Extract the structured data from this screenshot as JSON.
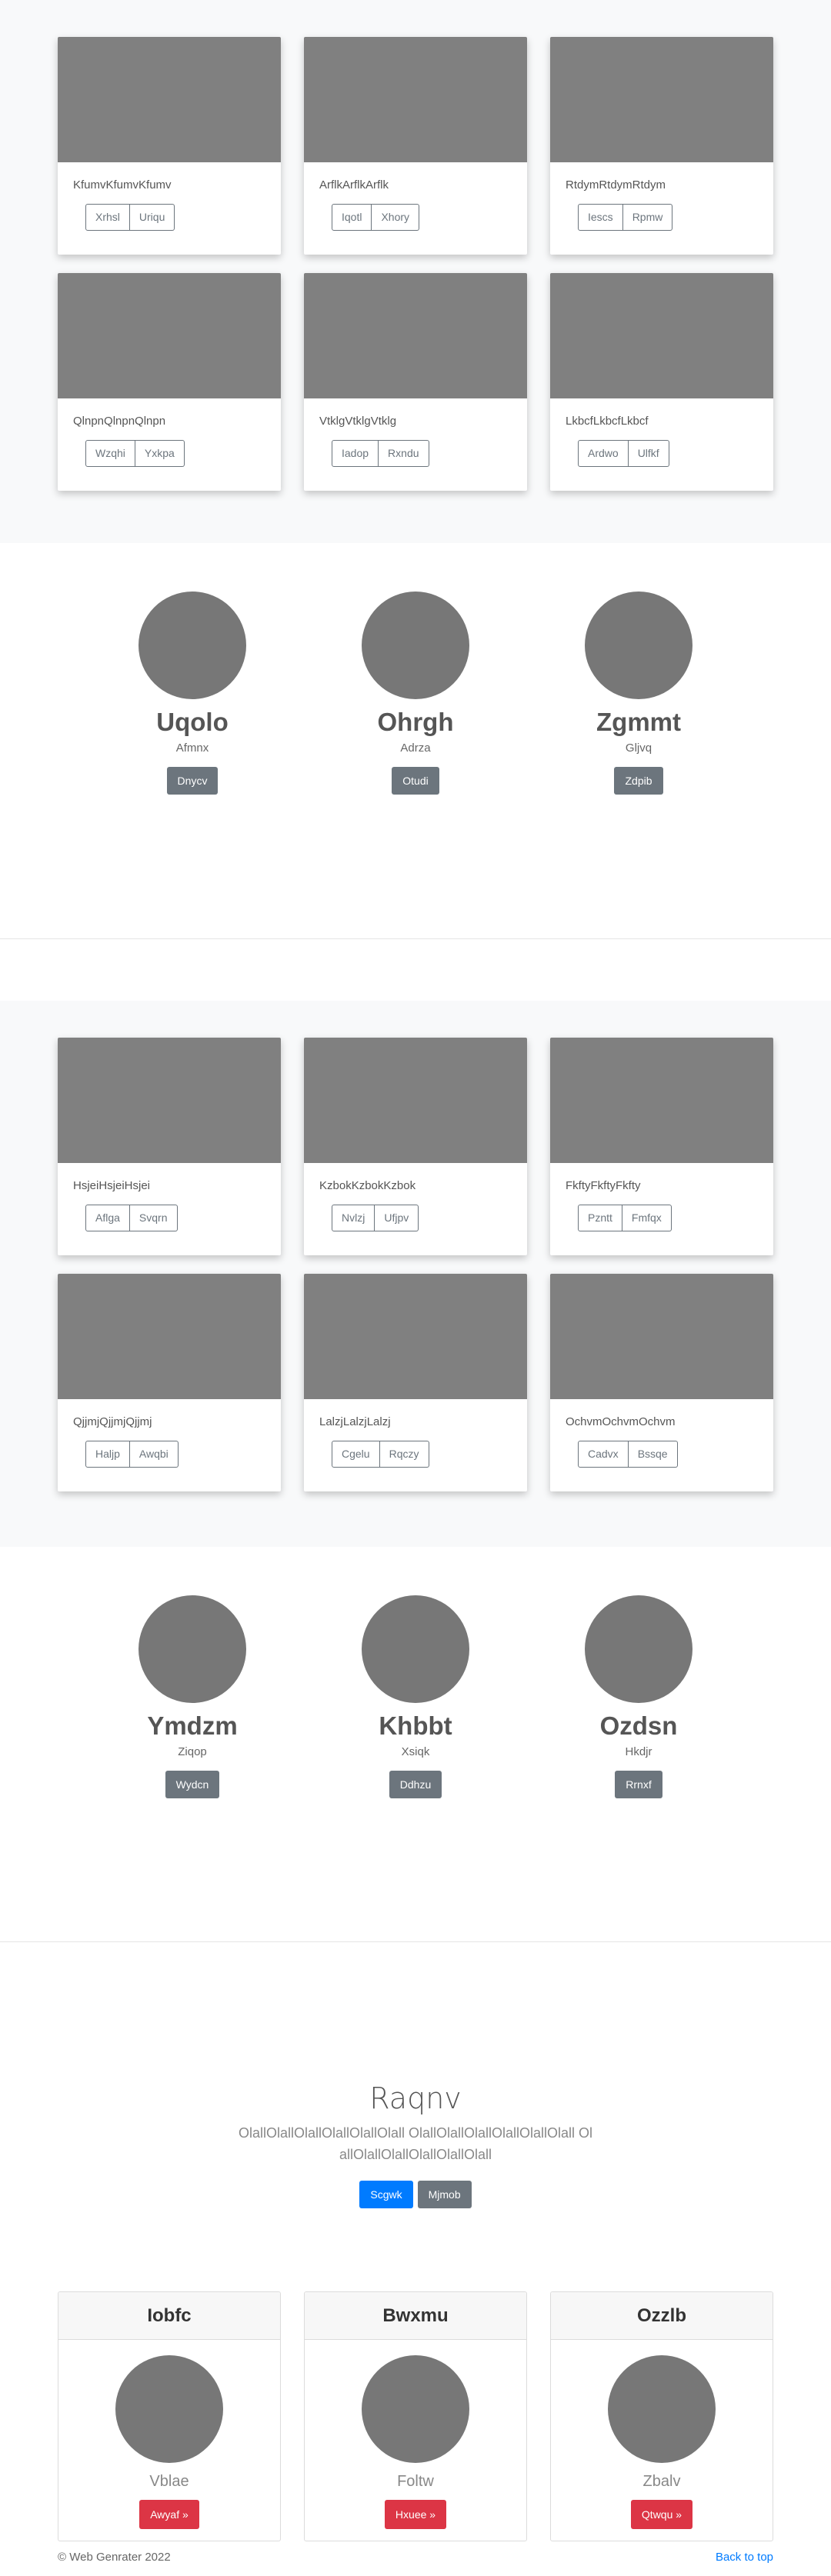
{
  "album1": {
    "cards": [
      {
        "text": "KfumvKfumvKfumv",
        "btn1": "Xrhsl",
        "btn2": "Uriqu"
      },
      {
        "text": "ArflkArflkArflk",
        "btn1": "Iqotl",
        "btn2": "Xhory"
      },
      {
        "text": "RtdymRtdymRtdym",
        "btn1": "Iescs",
        "btn2": "Rpmw"
      },
      {
        "text": "QlnpnQlnpnQlnpn",
        "btn1": "Wzqhi",
        "btn2": "Yxkpa"
      },
      {
        "text": "VtklgVtklgVtklg",
        "btn1": "Iadop",
        "btn2": "Rxndu"
      },
      {
        "text": "LkbcfLkbcfLkbcf",
        "btn1": "Ardwo",
        "btn2": "Ulfkf"
      }
    ]
  },
  "marketing1": {
    "items": [
      {
        "name": "Uqolo",
        "sub": "Afmnx",
        "btn": "Dnycv"
      },
      {
        "name": "Ohrgh",
        "sub": "Adrza",
        "btn": "Otudi"
      },
      {
        "name": "Zgmmt",
        "sub": "Gljvq",
        "btn": "Zdpib"
      }
    ]
  },
  "album2": {
    "cards": [
      {
        "text": "HsjeiHsjeiHsjei",
        "btn1": "Aflga",
        "btn2": "Svqrn"
      },
      {
        "text": "KzbokKzbokKzbok",
        "btn1": "Nvlzj",
        "btn2": "Ufjpv"
      },
      {
        "text": "FkftyFkftyFkfty",
        "btn1": "Pzntt",
        "btn2": "Fmfqx"
      },
      {
        "text": "QjjmjQjjmjQjjmj",
        "btn1": "Haljp",
        "btn2": "Awqbi"
      },
      {
        "text": "LalzjLalzjLalzj",
        "btn1": "Cgelu",
        "btn2": "Rqczy"
      },
      {
        "text": "OchvmOchvmOchvm",
        "btn1": "Cadvx",
        "btn2": "Bssqe"
      }
    ]
  },
  "marketing2": {
    "items": [
      {
        "name": "Ymdzm",
        "sub": "Ziqop",
        "btn": "Wydcn"
      },
      {
        "name": "Khbbt",
        "sub": "Xsiqk",
        "btn": "Ddhzu"
      },
      {
        "name": "Ozdsn",
        "sub": "Hkdjr",
        "btn": "Rrnxf"
      }
    ]
  },
  "jumbotron": {
    "title": "Raqnv",
    "lead": "OlallOlallOlallOlallOlallOlall OlallOlallOlallOlallOlallOlall OlallOlallOlallOlallOlallOlall",
    "primary_btn": "Scgwk",
    "secondary_btn": "Mjmob"
  },
  "pricing": {
    "cards": [
      {
        "header": "Iobfc",
        "sub": "Vblae",
        "btn": "Awyaf »"
      },
      {
        "header": "Bwxmu",
        "sub": "Foltw",
        "btn": "Hxuee »"
      },
      {
        "header": "Ozzlb",
        "sub": "Zbalv",
        "btn": "Qtwqu »"
      }
    ]
  },
  "footer": {
    "copyright": "© Web Genrater 2022",
    "back_to_top": "Back to top"
  },
  "colors": {
    "primary": "#007bff",
    "secondary": "#6c757d",
    "danger": "#dc3545",
    "placeholder": "#808080"
  }
}
